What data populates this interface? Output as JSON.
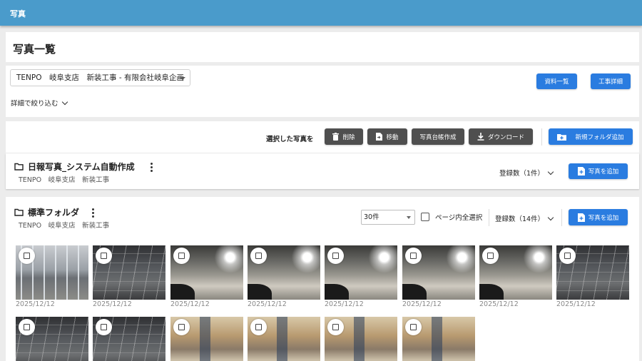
{
  "app": {
    "title": "写真"
  },
  "page": {
    "title": "写真一覧"
  },
  "project": {
    "selected": "TENPO　岐阜支店　新装工事 - 有限会社岐阜企画"
  },
  "filter": {
    "label": "詳細で絞り込む"
  },
  "header_buttons": {
    "documents": "資料一覧",
    "construction_details": "工事詳細"
  },
  "toolbar": {
    "selected_label": "選択した写真を",
    "delete": "削除",
    "move": "移動",
    "create_ledger": "写真台帳作成",
    "download": "ダウンロード",
    "new_folder": "新規フォルダ追加"
  },
  "folders": [
    {
      "name": "日報写真_システム自動作成",
      "subtitle": "TENPO　岐阜支店　新装工事",
      "count_label": "登録数（1件）",
      "add_button": "写真を追加"
    },
    {
      "name": "標準フォルダ",
      "subtitle": "TENPO　岐阜支店　新装工事",
      "count_label": "登録数（14件）",
      "add_button": "写真を追加",
      "per_page": "30件",
      "page_select_label": "ページ内全選択",
      "photos": [
        {
          "date": "2025/12/12",
          "style": "a"
        },
        {
          "date": "2025/12/12",
          "style": "b"
        },
        {
          "date": "2025/12/12",
          "style": "c"
        },
        {
          "date": "2025/12/12",
          "style": "c"
        },
        {
          "date": "2025/12/12",
          "style": "c"
        },
        {
          "date": "2025/12/12",
          "style": "c"
        },
        {
          "date": "2025/12/12",
          "style": "c"
        },
        {
          "date": "2025/12/12",
          "style": "b"
        },
        {
          "date": "",
          "style": "b"
        },
        {
          "date": "",
          "style": "b"
        },
        {
          "date": "",
          "style": "d"
        },
        {
          "date": "",
          "style": "d"
        },
        {
          "date": "",
          "style": "d"
        },
        {
          "date": "",
          "style": "d"
        }
      ]
    }
  ],
  "colors": {
    "appbar": "#4a9bcb",
    "primary_button": "#2a7ce0",
    "dark_button": "#4f4f4f",
    "background": "#ececec"
  },
  "icons": [
    "folder-icon",
    "kebab-menu-icon",
    "trash-icon",
    "move-file-icon",
    "download-icon",
    "folder-plus-icon",
    "file-plus-icon",
    "chevron-down-icon",
    "checkbox-icon"
  ]
}
